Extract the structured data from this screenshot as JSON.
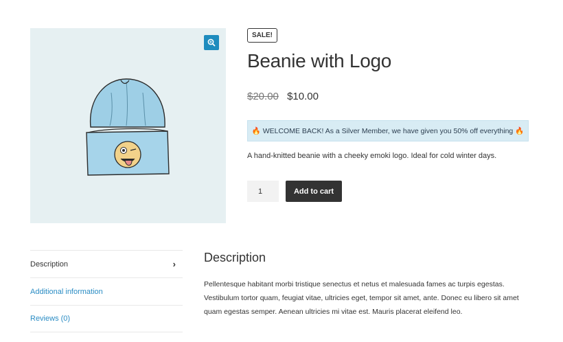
{
  "product": {
    "sale_badge": "SALE!",
    "title": "Beanie with Logo",
    "price_old": "$20.00",
    "price_new": "$10.00",
    "notice": "🔥 WELCOME BACK! As a Silver Member, we have given you 50% off everything 🔥",
    "short_description": "A hand-knitted beanie with a cheeky emoki logo. Ideal for cold winter days.",
    "quantity": "1",
    "add_to_cart_label": "Add to cart",
    "image_icon": "zoom-icon"
  },
  "tabs": {
    "items": [
      {
        "label": "Description",
        "active": true
      },
      {
        "label": "Additional information",
        "active": false
      },
      {
        "label": "Reviews (0)",
        "active": false
      }
    ]
  },
  "panel": {
    "heading": "Description",
    "body": "Pellentesque habitant morbi tristique senectus et netus et malesuada fames ac turpis egestas. Vestibulum tortor quam, feugiat vitae, ultricies eget, tempor sit amet, ante. Donec eu libero sit amet quam egestas semper. Aenean ultricies mi vitae est. Mauris placerat eleifend leo."
  },
  "colors": {
    "accent": "#1e8cbe",
    "link": "#2a8cc4",
    "notice_bg": "#d8ecf4",
    "button_bg": "#333333",
    "gallery_bg": "#e6f0f2"
  }
}
